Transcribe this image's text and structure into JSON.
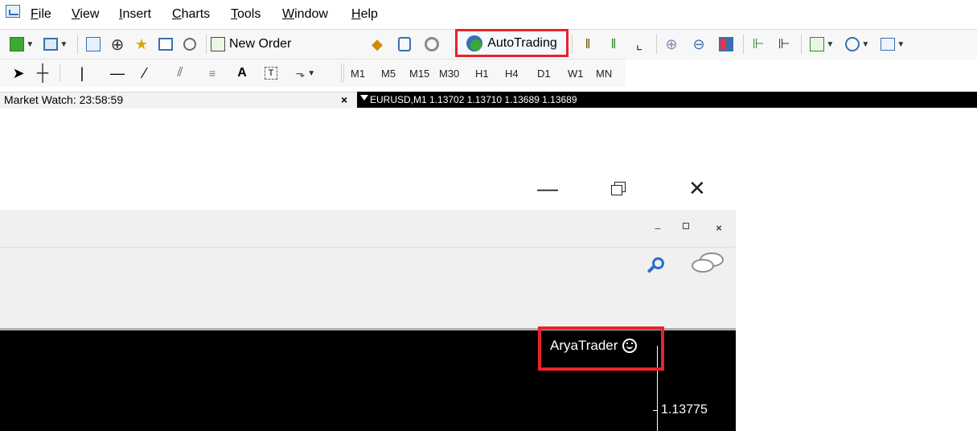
{
  "menu": {
    "items": [
      {
        "id": "file",
        "pre": "",
        "u": "F",
        "post": "ile"
      },
      {
        "id": "view",
        "pre": "",
        "u": "V",
        "post": "iew"
      },
      {
        "id": "insert",
        "pre": "",
        "u": "I",
        "post": "nsert"
      },
      {
        "id": "charts",
        "pre": "",
        "u": "C",
        "post": "harts"
      },
      {
        "id": "tools",
        "pre": "",
        "u": "T",
        "post": "ools"
      },
      {
        "id": "window",
        "pre": "",
        "u": "W",
        "post": "indow"
      },
      {
        "id": "help",
        "pre": "",
        "u": "H",
        "post": "elp"
      }
    ]
  },
  "toolbar": {
    "new_order": "New Order",
    "autotrading": "AutoTrading",
    "timeframes": [
      "M1",
      "M5",
      "M15",
      "M30",
      "H1",
      "H4",
      "D1",
      "W1",
      "MN"
    ],
    "text_tool": "A"
  },
  "market_watch": {
    "title": "Market Watch: 23:58:59",
    "close": "×"
  },
  "chart": {
    "info": "EURUSD,M1  1.13702 1.13710 1.13689 1.13689",
    "account": "AryaTrader",
    "price": "1.13775"
  },
  "window_controls": {
    "minimize": "—",
    "close": "✕"
  },
  "panel_controls": {
    "minimize": "–",
    "close": "×"
  },
  "colors": {
    "highlight": "#e8232a",
    "chart_bg": "#000000"
  }
}
